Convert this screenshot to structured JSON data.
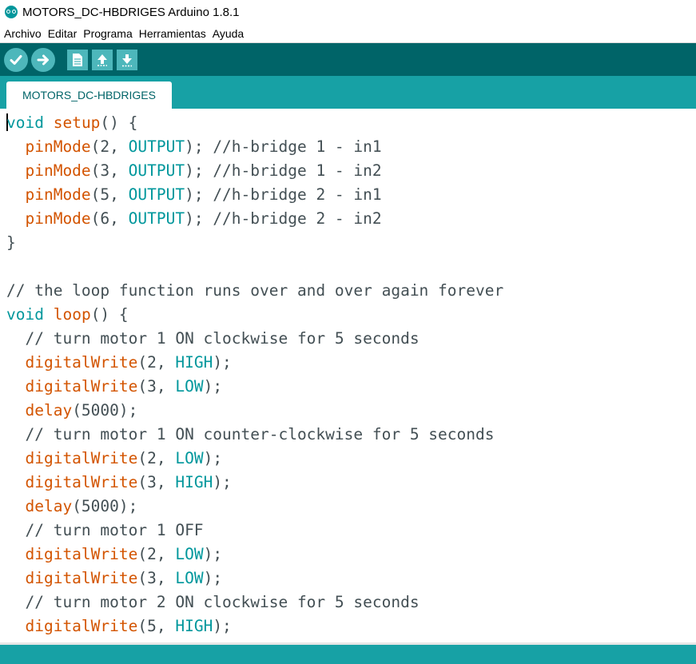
{
  "window": {
    "title": "MOTORS_DC-HBDRIGES Arduino 1.8.1"
  },
  "menu": [
    "Archivo",
    "Editar",
    "Programa",
    "Herramientas",
    "Ayuda"
  ],
  "toolbar": {
    "icons": [
      "verify-icon",
      "upload-icon",
      "new-icon",
      "open-icon",
      "save-icon"
    ]
  },
  "tab": {
    "label": "MOTORS_DC-HBDRIGES"
  },
  "colors": {
    "keyword": "#00979c",
    "function": "#d35400",
    "constant": "#00979c",
    "text": "#434f54",
    "toolbar_bg": "#006468",
    "tabbar_bg": "#17a1a5"
  },
  "code_lines": [
    [
      {
        "t": "void",
        "c": "kw"
      },
      {
        "t": " "
      },
      {
        "t": "setup",
        "c": "fn"
      },
      {
        "t": "() {"
      }
    ],
    [
      {
        "t": "  "
      },
      {
        "t": "pinMode",
        "c": "fn"
      },
      {
        "t": "(2, "
      },
      {
        "t": "OUTPUT",
        "c": "ct"
      },
      {
        "t": "); //h-bridge 1 - in1"
      }
    ],
    [
      {
        "t": "  "
      },
      {
        "t": "pinMode",
        "c": "fn"
      },
      {
        "t": "(3, "
      },
      {
        "t": "OUTPUT",
        "c": "ct"
      },
      {
        "t": "); //h-bridge 1 - in2"
      }
    ],
    [
      {
        "t": "  "
      },
      {
        "t": "pinMode",
        "c": "fn"
      },
      {
        "t": "(5, "
      },
      {
        "t": "OUTPUT",
        "c": "ct"
      },
      {
        "t": "); //h-bridge 2 - in1"
      }
    ],
    [
      {
        "t": "  "
      },
      {
        "t": "pinMode",
        "c": "fn"
      },
      {
        "t": "(6, "
      },
      {
        "t": "OUTPUT",
        "c": "ct"
      },
      {
        "t": "); //h-bridge 2 - in2"
      }
    ],
    [
      {
        "t": "}"
      }
    ],
    [],
    [
      {
        "t": "// the loop function runs over and over again forever",
        "c": "cm"
      }
    ],
    [
      {
        "t": "void",
        "c": "kw"
      },
      {
        "t": " "
      },
      {
        "t": "loop",
        "c": "fn"
      },
      {
        "t": "() {"
      }
    ],
    [
      {
        "t": "  "
      },
      {
        "t": "// turn motor 1 ON clockwise for 5 seconds",
        "c": "cm"
      }
    ],
    [
      {
        "t": "  "
      },
      {
        "t": "digitalWrite",
        "c": "fn"
      },
      {
        "t": "(2, "
      },
      {
        "t": "HIGH",
        "c": "ct"
      },
      {
        "t": ");"
      }
    ],
    [
      {
        "t": "  "
      },
      {
        "t": "digitalWrite",
        "c": "fn"
      },
      {
        "t": "(3, "
      },
      {
        "t": "LOW",
        "c": "ct"
      },
      {
        "t": ");"
      }
    ],
    [
      {
        "t": "  "
      },
      {
        "t": "delay",
        "c": "fn"
      },
      {
        "t": "(5000);"
      }
    ],
    [
      {
        "t": "  "
      },
      {
        "t": "// turn motor 1 ON counter-clockwise for 5 seconds",
        "c": "cm"
      }
    ],
    [
      {
        "t": "  "
      },
      {
        "t": "digitalWrite",
        "c": "fn"
      },
      {
        "t": "(2, "
      },
      {
        "t": "LOW",
        "c": "ct"
      },
      {
        "t": ");"
      }
    ],
    [
      {
        "t": "  "
      },
      {
        "t": "digitalWrite",
        "c": "fn"
      },
      {
        "t": "(3, "
      },
      {
        "t": "HIGH",
        "c": "ct"
      },
      {
        "t": ");"
      }
    ],
    [
      {
        "t": "  "
      },
      {
        "t": "delay",
        "c": "fn"
      },
      {
        "t": "(5000);"
      }
    ],
    [
      {
        "t": "  "
      },
      {
        "t": "// turn motor 1 OFF",
        "c": "cm"
      }
    ],
    [
      {
        "t": "  "
      },
      {
        "t": "digitalWrite",
        "c": "fn"
      },
      {
        "t": "(2, "
      },
      {
        "t": "LOW",
        "c": "ct"
      },
      {
        "t": ");"
      }
    ],
    [
      {
        "t": "  "
      },
      {
        "t": "digitalWrite",
        "c": "fn"
      },
      {
        "t": "(3, "
      },
      {
        "t": "LOW",
        "c": "ct"
      },
      {
        "t": ");"
      }
    ],
    [
      {
        "t": "  "
      },
      {
        "t": "// turn motor 2 ON clockwise for 5 seconds",
        "c": "cm"
      }
    ],
    [
      {
        "t": "  "
      },
      {
        "t": "digitalWrite",
        "c": "fn"
      },
      {
        "t": "(5, "
      },
      {
        "t": "HIGH",
        "c": "ct"
      },
      {
        "t": ");"
      }
    ]
  ]
}
